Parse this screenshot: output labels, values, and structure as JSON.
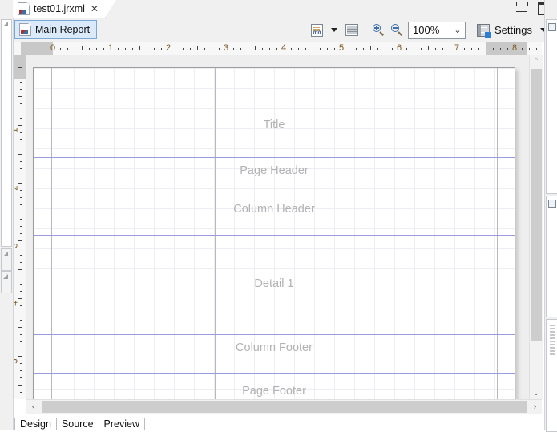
{
  "window": {
    "tab_title": "test01.jrxml",
    "tab_close_glyph": "✕",
    "minimize_glyph": "minimize",
    "maximize_glyph": "maximize"
  },
  "report_tab": {
    "label": "Main Report",
    "icon": "report-document-icon"
  },
  "toolbar": {
    "dataset_icon": "dataset-icon",
    "dataset_bits": "010",
    "dataset_caret": "▼",
    "list_icon": "band-list-icon",
    "zoom_in_icon": "zoom-in-icon",
    "zoom_out_icon": "zoom-out-icon",
    "zoom_value": "100%",
    "zoom_chevron": "⌄",
    "settings_icon": "settings-icon",
    "settings_label": "Settings",
    "settings_caret": "▼"
  },
  "rulers": {
    "h_labels": [
      "0",
      "1",
      "2",
      "3",
      "4",
      "5",
      "6",
      "7",
      "8"
    ],
    "v_labels": [
      "1",
      "2",
      "3",
      "4",
      "5"
    ],
    "unit_color": "#7a5a20"
  },
  "canvas": {
    "bands": [
      {
        "name": "Title",
        "label": "Title"
      },
      {
        "name": "Page Header",
        "label": "Page Header"
      },
      {
        "name": "Column Header",
        "label": "Column Header"
      },
      {
        "name": "Detail 1",
        "label": "Detail 1"
      },
      {
        "name": "Column Footer",
        "label": "Column Footer"
      },
      {
        "name": "Page Footer",
        "label": "Page Footer"
      }
    ],
    "guide_color": "#9a9ae0",
    "grid_color": "#ededf3",
    "label_color": "#b2b2b2"
  },
  "scrollbars": {
    "v_up": "⌃",
    "v_down": "⌄",
    "h_left": "‹",
    "h_right": "›"
  },
  "bottom_tabs": [
    {
      "label": "Design",
      "active": true
    },
    {
      "label": "Source",
      "active": false
    },
    {
      "label": "Preview",
      "active": false
    }
  ]
}
